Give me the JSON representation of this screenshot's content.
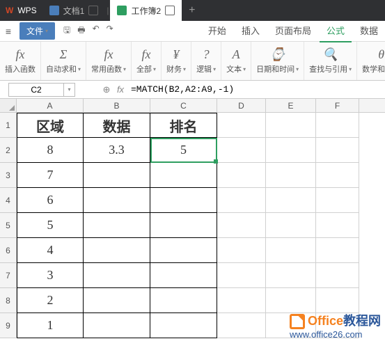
{
  "titlebar": {
    "home": "WPS",
    "tabs": [
      {
        "label": "文档1"
      },
      {
        "label": "工作簿2",
        "active": true
      }
    ]
  },
  "menubar": {
    "file": "文件",
    "tabs": {
      "start": "开始",
      "insert": "插入",
      "layout": "页面布局",
      "formula": "公式",
      "data": "数据"
    }
  },
  "ribbon": {
    "g1": {
      "ico": "fx",
      "lbl": "插入函数"
    },
    "g2": {
      "ico": "Σ",
      "lbl": "自动求和"
    },
    "g3": {
      "ico": "fx",
      "lbl": "常用函数"
    },
    "g4": {
      "ico": "fx",
      "lbl": "全部"
    },
    "g5": {
      "ico": "¥",
      "lbl": "财务"
    },
    "g6": {
      "ico": "?",
      "lbl": "逻辑"
    },
    "g7": {
      "ico": "A",
      "lbl": "文本"
    },
    "g8": {
      "ico": "⌚",
      "lbl": "日期和时间"
    },
    "g9": {
      "ico": "🔍",
      "lbl": "查找与引用"
    },
    "g10": {
      "ico": "θ",
      "lbl": "数学和三角"
    }
  },
  "namebox": "C2",
  "formula": "=MATCH(B2,A2:A9,-1)",
  "cols": [
    "A",
    "B",
    "C",
    "D",
    "E",
    "F"
  ],
  "rows": [
    "1",
    "2",
    "3",
    "4",
    "5",
    "6",
    "7",
    "8",
    "9"
  ],
  "sheet": {
    "header": {
      "A": "区域",
      "B": "数据",
      "C": "排名"
    },
    "data": [
      {
        "A": "8",
        "B": "3.3",
        "C": "5"
      },
      {
        "A": "7",
        "B": "",
        "C": ""
      },
      {
        "A": "6",
        "B": "",
        "C": ""
      },
      {
        "A": "5",
        "B": "",
        "C": ""
      },
      {
        "A": "4",
        "B": "",
        "C": ""
      },
      {
        "A": "3",
        "B": "",
        "C": ""
      },
      {
        "A": "2",
        "B": "",
        "C": ""
      },
      {
        "A": "1",
        "B": "",
        "C": ""
      }
    ]
  },
  "watermark": {
    "line1_a": "Office",
    "line1_b": "教程网",
    "line2": "www.office26.com"
  }
}
